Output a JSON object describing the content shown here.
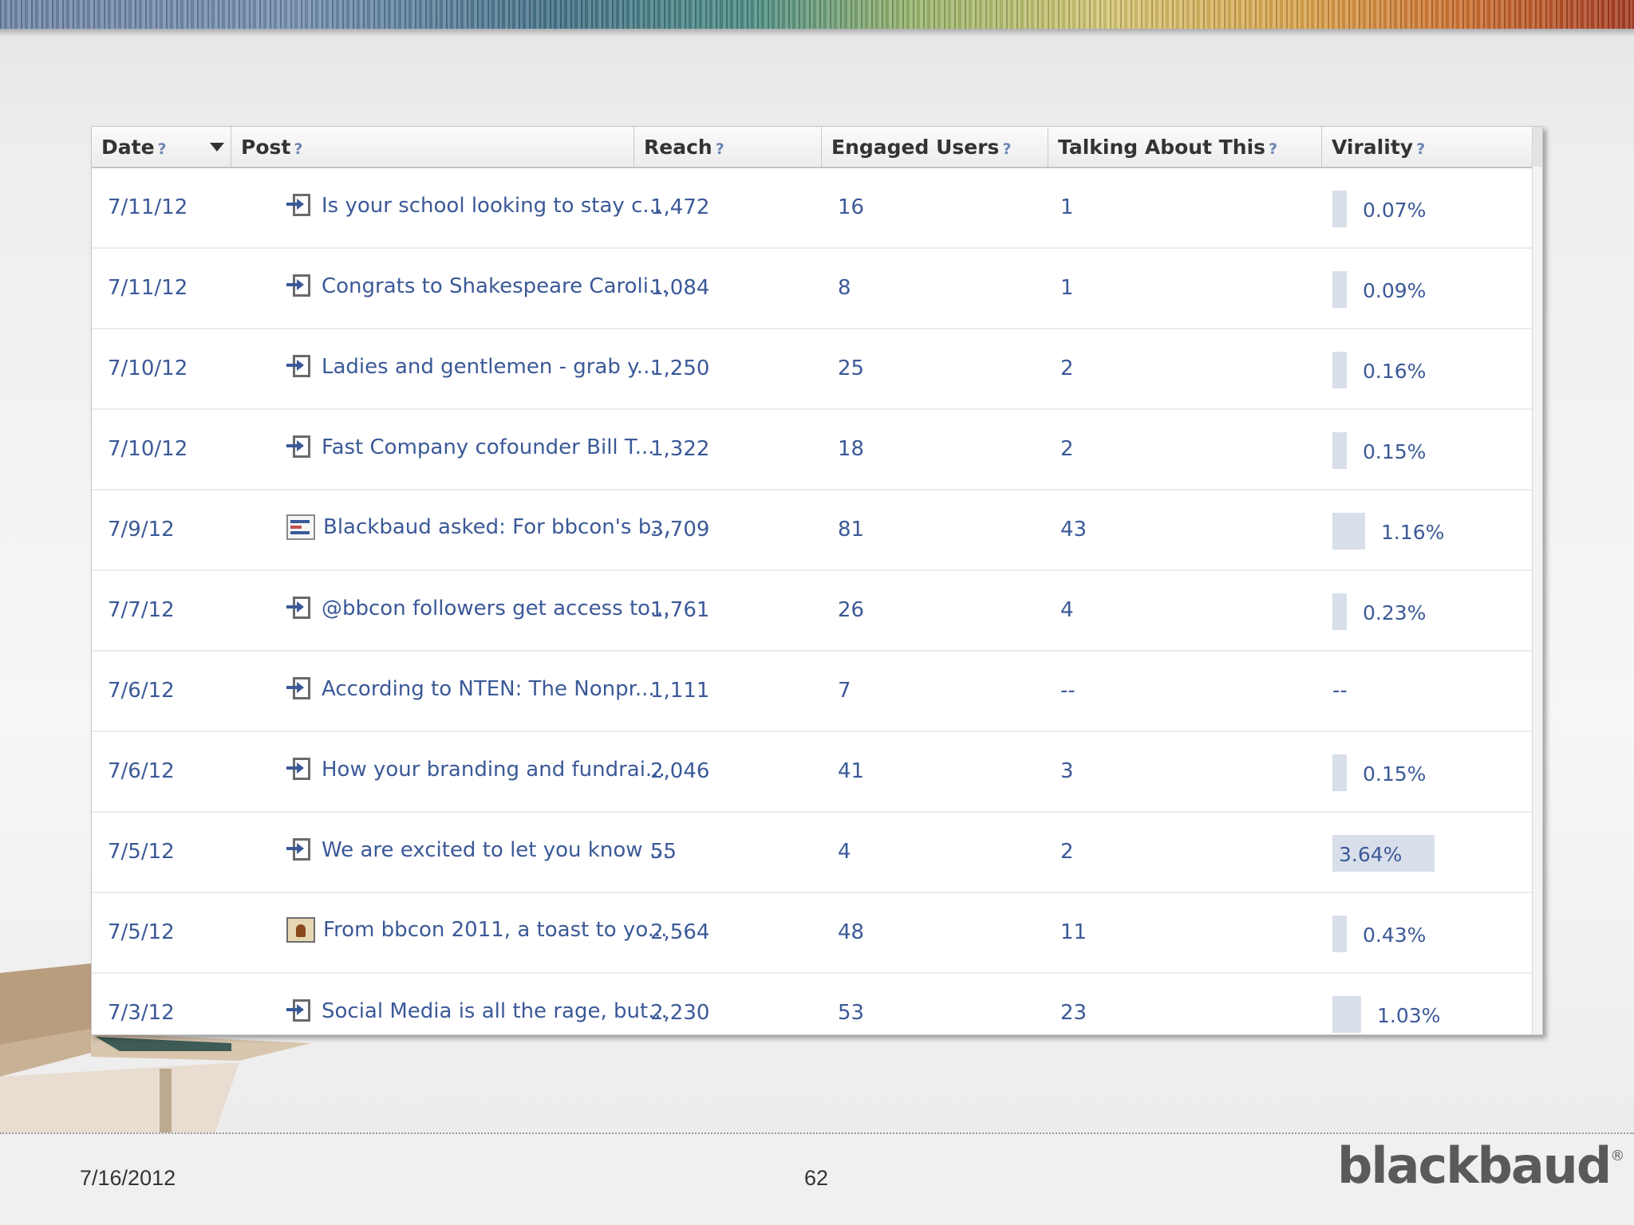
{
  "table": {
    "columns": [
      {
        "label": "Date",
        "help": "?"
      },
      {
        "label": "Post",
        "help": "?"
      },
      {
        "label": "Reach",
        "help": "?"
      },
      {
        "label": "Engaged Users",
        "help": "?"
      },
      {
        "label": "Talking About This",
        "help": "?"
      },
      {
        "label": "Virality",
        "help": "?"
      }
    ],
    "rows": [
      {
        "date": "7/11/12",
        "icon": "status-link-icon",
        "post": "Is your school looking to stay c...",
        "reach": "1,472",
        "engaged": "16",
        "talking": "1",
        "virality": "0.07%",
        "virality_value": 0.07
      },
      {
        "date": "7/11/12",
        "icon": "status-link-icon",
        "post": "Congrats to Shakespeare Caroli...",
        "reach": "1,084",
        "engaged": "8",
        "talking": "1",
        "virality": "0.09%",
        "virality_value": 0.09
      },
      {
        "date": "7/10/12",
        "icon": "status-link-icon",
        "post": "Ladies and gentlemen - grab y...",
        "reach": "1,250",
        "engaged": "25",
        "talking": "2",
        "virality": "0.16%",
        "virality_value": 0.16
      },
      {
        "date": "7/10/12",
        "icon": "status-link-icon",
        "post": "Fast Company cofounder Bill T...",
        "reach": "1,322",
        "engaged": "18",
        "talking": "2",
        "virality": "0.15%",
        "virality_value": 0.15
      },
      {
        "date": "7/9/12",
        "icon": "question-icon",
        "post": "Blackbaud asked: For bbcon's b...",
        "reach": "3,709",
        "engaged": "81",
        "talking": "43",
        "virality": "1.16%",
        "virality_value": 1.16
      },
      {
        "date": "7/7/12",
        "icon": "status-link-icon",
        "post": "@bbcon followers get access to...",
        "reach": "1,761",
        "engaged": "26",
        "talking": "4",
        "virality": "0.23%",
        "virality_value": 0.23
      },
      {
        "date": "7/6/12",
        "icon": "status-link-icon",
        "post": "According to NTEN: The Nonpr...",
        "reach": "1,111",
        "engaged": "7",
        "talking": "--",
        "virality": "--",
        "virality_value": null
      },
      {
        "date": "7/6/12",
        "icon": "status-link-icon",
        "post": "How your branding and fundrai...",
        "reach": "2,046",
        "engaged": "41",
        "talking": "3",
        "virality": "0.15%",
        "virality_value": 0.15
      },
      {
        "date": "7/5/12",
        "icon": "status-link-icon",
        "post": "We are excited to let you know ...",
        "reach": "55",
        "engaged": "4",
        "talking": "2",
        "virality": "3.64%",
        "virality_value": 3.64
      },
      {
        "date": "7/5/12",
        "icon": "photo-icon",
        "post": "From bbcon 2011, a toast to yo...",
        "reach": "2,564",
        "engaged": "48",
        "talking": "11",
        "virality": "0.43%",
        "virality_value": 0.43
      },
      {
        "date": "7/3/12",
        "icon": "status-link-icon",
        "post": "Social Media is all the rage, but...",
        "reach": "2,230",
        "engaged": "53",
        "talking": "23",
        "virality": "1.03%",
        "virality_value": 1.03
      }
    ]
  },
  "footer": {
    "date": "7/16/2012",
    "page": "62",
    "logo": "blackbaud",
    "logo_mark": "®"
  },
  "colors": {
    "link": "#3b5998",
    "virality_bar": "#d8dfea",
    "header_text": "#333333"
  }
}
